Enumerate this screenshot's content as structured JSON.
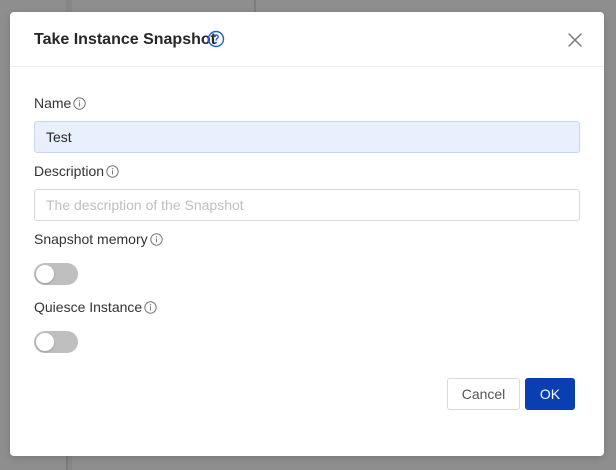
{
  "dialog": {
    "title": "Take Instance Snapshot",
    "help_icon": "question-circle-icon",
    "close_icon": "close-icon"
  },
  "fields": {
    "name": {
      "label": "Name",
      "value": "Test",
      "info_icon": "info-circle-icon"
    },
    "description": {
      "label": "Description",
      "value": "",
      "placeholder": "The description of the Snapshot",
      "info_icon": "info-circle-icon"
    },
    "snapshot_memory": {
      "label": "Snapshot memory",
      "enabled": false,
      "info_icon": "info-circle-icon"
    },
    "quiesce_instance": {
      "label": "Quiesce Instance",
      "enabled": false,
      "info_icon": "info-circle-icon"
    }
  },
  "footer": {
    "cancel_label": "Cancel",
    "ok_label": "OK"
  },
  "colors": {
    "primary": "#0a3fb3",
    "help_icon": "#1f5fd6",
    "toggle_off": "#bfbfbf",
    "filled_input_bg": "#e8f0fe",
    "overlay": "#8e8e8e"
  }
}
